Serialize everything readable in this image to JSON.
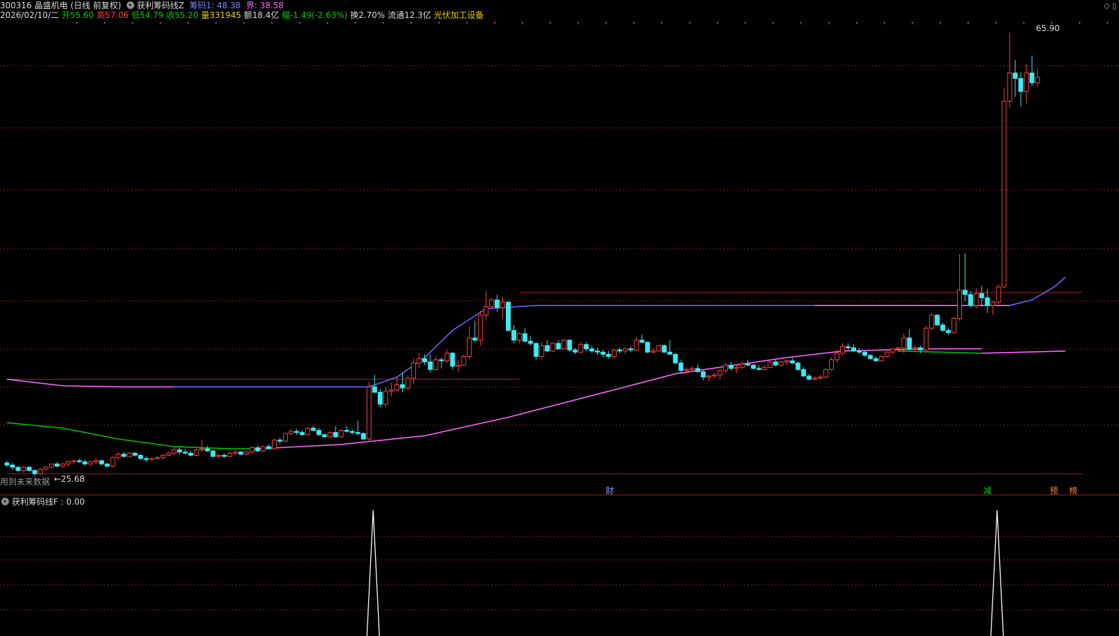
{
  "header": {
    "code": "300316",
    "name": "晶盛机电",
    "mode": "(日线 前复权)",
    "indicator": "获利筹码线Z",
    "chip1_label": "筹码1: 48.38",
    "jie_label": "界: 38.58"
  },
  "quote": {
    "date": "2026/02/10/二",
    "open": "开55.60",
    "high": "高57.06",
    "low": "低54.79",
    "close": "收55.20",
    "volume": "量331945",
    "amount": "额18.4亿",
    "change": "幅-1.49(-2.63%)",
    "turnover": "换2.70%",
    "float": "流通12.3亿",
    "sector": "光伏加工设备"
  },
  "annotations": {
    "future_data": "用到未来数据",
    "low_marker": "←25.68",
    "high_marker": "65.90",
    "event_cai": "财",
    "event_jian": "减",
    "event_yu": "预",
    "event_bang": "榜"
  },
  "sub_panel": {
    "title": "获利筹码线F",
    "value": ": 0.00"
  },
  "colors": {
    "up": "#ff4040",
    "down": "#40e8f0",
    "grid": "#8b1a1a",
    "line_blue": "#6666ff",
    "line_magenta": "#ff66ff",
    "line_green": "#00c000"
  },
  "chart_data": {
    "type": "candlestick",
    "price_range": [
      25.68,
      65.9
    ],
    "candles": [
      [
        26.3,
        26.5,
        25.9,
        26.1
      ],
      [
        26.1,
        26.3,
        25.7,
        25.9
      ],
      [
        25.9,
        26.0,
        25.5,
        25.6
      ],
      [
        25.6,
        26.0,
        25.4,
        25.9
      ],
      [
        25.9,
        26.0,
        25.5,
        25.6
      ],
      [
        25.6,
        25.7,
        25.1,
        25.3
      ],
      [
        25.3,
        25.8,
        25.2,
        25.7
      ],
      [
        25.7,
        26.0,
        25.6,
        25.9
      ],
      [
        25.9,
        26.2,
        25.8,
        26.2
      ],
      [
        26.2,
        26.4,
        25.9,
        26.0
      ],
      [
        26.0,
        26.3,
        25.9,
        26.2
      ],
      [
        26.2,
        26.5,
        26.0,
        26.4
      ],
      [
        26.4,
        26.6,
        26.2,
        26.5
      ],
      [
        26.5,
        26.7,
        26.3,
        26.4
      ],
      [
        26.4,
        26.6,
        26.1,
        26.2
      ],
      [
        26.2,
        26.5,
        26.1,
        26.4
      ],
      [
        26.4,
        26.7,
        26.2,
        26.5
      ],
      [
        26.5,
        26.6,
        26.1,
        26.2
      ],
      [
        26.2,
        26.3,
        25.9,
        26.0
      ],
      [
        26.0,
        26.9,
        25.9,
        26.8
      ],
      [
        26.8,
        27.3,
        26.6,
        27.1
      ],
      [
        27.1,
        27.3,
        26.8,
        26.9
      ],
      [
        26.9,
        27.3,
        26.9,
        27.2
      ],
      [
        27.2,
        27.3,
        26.9,
        27.0
      ],
      [
        27.0,
        27.1,
        26.6,
        26.7
      ],
      [
        26.7,
        26.9,
        26.4,
        26.6
      ],
      [
        26.6,
        26.8,
        26.5,
        26.7
      ],
      [
        26.7,
        26.9,
        26.6,
        26.8
      ],
      [
        26.8,
        27.1,
        26.6,
        27.0
      ],
      [
        27.0,
        27.3,
        26.9,
        27.2
      ],
      [
        27.2,
        27.7,
        27.0,
        27.5
      ],
      [
        27.5,
        27.7,
        27.1,
        27.3
      ],
      [
        27.3,
        27.6,
        27.1,
        27.2
      ],
      [
        27.2,
        27.4,
        26.9,
        27.0
      ],
      [
        27.0,
        27.6,
        26.9,
        27.5
      ],
      [
        27.5,
        28.4,
        27.3,
        27.6
      ],
      [
        27.6,
        27.9,
        27.3,
        27.4
      ],
      [
        27.4,
        27.5,
        26.8,
        26.9
      ],
      [
        26.9,
        27.1,
        26.8,
        27.0
      ],
      [
        27.0,
        27.2,
        26.8,
        26.9
      ],
      [
        26.9,
        27.3,
        26.8,
        27.2
      ],
      [
        27.2,
        27.5,
        27.0,
        27.3
      ],
      [
        27.3,
        27.4,
        27.0,
        27.1
      ],
      [
        27.1,
        27.4,
        27.0,
        27.3
      ],
      [
        27.3,
        27.8,
        27.2,
        27.7
      ],
      [
        27.7,
        27.9,
        27.3,
        27.4
      ],
      [
        27.4,
        27.9,
        27.3,
        27.8
      ],
      [
        27.8,
        28.0,
        27.5,
        27.6
      ],
      [
        27.6,
        28.5,
        27.5,
        28.4
      ],
      [
        28.4,
        28.6,
        28.1,
        28.3
      ],
      [
        28.3,
        29.1,
        28.2,
        29.0
      ],
      [
        29.0,
        29.4,
        28.8,
        29.2
      ],
      [
        29.2,
        29.4,
        28.9,
        29.1
      ],
      [
        29.1,
        29.3,
        28.8,
        28.9
      ],
      [
        28.9,
        29.6,
        28.8,
        29.5
      ],
      [
        29.5,
        29.7,
        29.2,
        29.3
      ],
      [
        29.3,
        29.5,
        28.8,
        28.9
      ],
      [
        28.9,
        29.0,
        28.6,
        28.7
      ],
      [
        28.7,
        29.2,
        28.6,
        29.1
      ],
      [
        29.1,
        29.7,
        28.6,
        28.7
      ],
      [
        28.7,
        29.4,
        28.6,
        29.3
      ],
      [
        29.3,
        29.7,
        29.1,
        29.2
      ],
      [
        29.2,
        29.4,
        28.9,
        29.1
      ],
      [
        29.1,
        30.2,
        28.8,
        29.0
      ],
      [
        29.0,
        29.1,
        28.4,
        28.5
      ],
      [
        28.5,
        33.8,
        28.3,
        33.3
      ],
      [
        33.3,
        34.4,
        32.8,
        32.8
      ],
      [
        32.8,
        33.1,
        31.4,
        31.7
      ],
      [
        31.7,
        33.3,
        31.4,
        32.9
      ],
      [
        32.9,
        33.7,
        32.4,
        33.0
      ],
      [
        33.0,
        34.3,
        32.9,
        33.5
      ],
      [
        33.5,
        34.6,
        32.8,
        33.2
      ],
      [
        33.2,
        34.3,
        33.0,
        34.1
      ],
      [
        34.1,
        35.9,
        33.6,
        35.5
      ],
      [
        35.5,
        36.4,
        35.0,
        35.9
      ],
      [
        35.9,
        36.3,
        35.3,
        35.6
      ],
      [
        35.6,
        36.3,
        34.6,
        34.9
      ],
      [
        34.9,
        36.1,
        34.8,
        35.8
      ],
      [
        35.8,
        36.0,
        35.0,
        35.7
      ],
      [
        35.7,
        36.7,
        35.5,
        36.4
      ],
      [
        36.4,
        36.5,
        34.9,
        35.2
      ],
      [
        35.2,
        35.8,
        34.7,
        35.3
      ],
      [
        35.3,
        36.3,
        35.2,
        36.1
      ],
      [
        36.1,
        38.9,
        35.8,
        37.8
      ],
      [
        37.8,
        39.4,
        37.4,
        37.6
      ],
      [
        37.6,
        40.3,
        37.1,
        39.9
      ],
      [
        39.9,
        42.1,
        39.4,
        40.7
      ],
      [
        40.7,
        41.5,
        40.5,
        41.3
      ],
      [
        41.3,
        41.8,
        40.2,
        40.6
      ],
      [
        40.6,
        41.6,
        39.6,
        41.1
      ],
      [
        41.1,
        41.2,
        38.4,
        38.5
      ],
      [
        38.5,
        39.0,
        37.3,
        37.6
      ],
      [
        37.6,
        38.3,
        37.3,
        38.2
      ],
      [
        38.2,
        38.7,
        37.4,
        37.5
      ],
      [
        37.5,
        38.0,
        37.1,
        37.3
      ],
      [
        37.3,
        37.4,
        35.8,
        36.1
      ],
      [
        36.1,
        37.4,
        35.9,
        37.1
      ],
      [
        37.1,
        37.6,
        36.5,
        36.6
      ],
      [
        36.6,
        37.4,
        36.5,
        37.3
      ],
      [
        37.3,
        37.6,
        36.7,
        36.8
      ],
      [
        36.8,
        37.7,
        36.7,
        37.6
      ],
      [
        37.6,
        37.7,
        36.5,
        36.7
      ],
      [
        36.7,
        36.9,
        36.3,
        36.5
      ],
      [
        36.5,
        37.4,
        36.4,
        37.2
      ],
      [
        37.2,
        37.4,
        36.6,
        36.8
      ],
      [
        36.8,
        37.1,
        36.4,
        36.6
      ],
      [
        36.6,
        36.9,
        36.2,
        36.5
      ],
      [
        36.5,
        36.7,
        36.0,
        36.3
      ],
      [
        36.3,
        36.6,
        35.9,
        36.1
      ],
      [
        36.1,
        36.8,
        35.9,
        36.7
      ],
      [
        36.7,
        36.9,
        36.4,
        36.6
      ],
      [
        36.6,
        36.9,
        36.3,
        36.8
      ],
      [
        36.8,
        37.0,
        36.5,
        36.7
      ],
      [
        36.7,
        37.9,
        36.6,
        37.6
      ],
      [
        37.6,
        38.1,
        37.3,
        37.4
      ],
      [
        37.4,
        37.5,
        36.4,
        36.5
      ],
      [
        36.5,
        36.9,
        36.4,
        36.6
      ],
      [
        36.6,
        37.2,
        36.5,
        37.1
      ],
      [
        37.1,
        37.2,
        36.4,
        36.5
      ],
      [
        36.5,
        37.6,
        36.3,
        36.3
      ],
      [
        36.3,
        36.4,
        35.4,
        35.5
      ],
      [
        35.5,
        35.8,
        34.5,
        34.8
      ],
      [
        34.8,
        35.1,
        34.5,
        34.9
      ],
      [
        34.9,
        35.2,
        34.7,
        35.0
      ],
      [
        35.0,
        35.4,
        34.6,
        34.7
      ],
      [
        34.7,
        34.8,
        33.9,
        34.2
      ],
      [
        34.2,
        34.4,
        33.8,
        34.3
      ],
      [
        34.3,
        34.6,
        34.1,
        34.4
      ],
      [
        34.4,
        35.0,
        34.0,
        34.8
      ],
      [
        34.8,
        35.5,
        34.6,
        35.3
      ],
      [
        35.3,
        35.6,
        34.8,
        35.0
      ],
      [
        35.0,
        35.3,
        34.6,
        35.1
      ],
      [
        35.1,
        35.6,
        34.9,
        35.4
      ],
      [
        35.4,
        35.8,
        35.2,
        35.3
      ],
      [
        35.3,
        35.4,
        34.9,
        35.0
      ],
      [
        35.0,
        35.3,
        34.8,
        34.9
      ],
      [
        34.9,
        35.3,
        34.8,
        35.1
      ],
      [
        35.1,
        35.7,
        35.0,
        35.6
      ],
      [
        35.6,
        35.9,
        35.2,
        35.3
      ],
      [
        35.3,
        35.7,
        35.2,
        35.6
      ],
      [
        35.6,
        35.8,
        35.3,
        35.7
      ],
      [
        35.7,
        36.0,
        35.4,
        35.5
      ],
      [
        35.5,
        35.6,
        34.8,
        34.9
      ],
      [
        34.9,
        35.1,
        34.2,
        34.3
      ],
      [
        34.3,
        34.5,
        33.9,
        34.0
      ],
      [
        34.0,
        34.3,
        33.9,
        34.1
      ],
      [
        34.1,
        34.4,
        34.0,
        34.2
      ],
      [
        34.2,
        35.0,
        34.1,
        34.9
      ],
      [
        34.9,
        36.0,
        34.8,
        35.8
      ],
      [
        35.8,
        36.7,
        35.5,
        36.4
      ],
      [
        36.4,
        37.3,
        36.2,
        37.0
      ],
      [
        37.0,
        37.3,
        36.7,
        36.9
      ],
      [
        36.9,
        37.2,
        36.5,
        36.6
      ],
      [
        36.6,
        36.9,
        36.3,
        36.5
      ],
      [
        36.5,
        36.6,
        36.1,
        36.2
      ],
      [
        36.2,
        36.3,
        35.8,
        35.9
      ],
      [
        35.9,
        36.1,
        35.6,
        35.7
      ],
      [
        35.7,
        36.2,
        35.6,
        36.1
      ],
      [
        36.1,
        36.6,
        36.0,
        36.5
      ],
      [
        36.5,
        36.9,
        36.3,
        36.8
      ],
      [
        36.8,
        37.0,
        36.5,
        36.9
      ],
      [
        36.9,
        38.2,
        36.4,
        37.8
      ],
      [
        37.8,
        38.6,
        36.6,
        36.8
      ],
      [
        36.8,
        37.2,
        36.5,
        36.9
      ],
      [
        36.9,
        37.1,
        36.4,
        36.7
      ],
      [
        36.7,
        38.9,
        36.6,
        38.7
      ],
      [
        38.7,
        40.1,
        38.5,
        39.9
      ],
      [
        39.9,
        40.0,
        38.9,
        39.0
      ],
      [
        39.0,
        39.2,
        38.4,
        38.5
      ],
      [
        38.5,
        38.7,
        38.1,
        38.3
      ],
      [
        38.3,
        39.7,
        38.2,
        39.6
      ],
      [
        39.6,
        45.5,
        39.4,
        42.2
      ],
      [
        42.2,
        45.6,
        41.2,
        41.8
      ],
      [
        41.8,
        42.1,
        40.6,
        40.8
      ],
      [
        40.8,
        42.4,
        40.5,
        41.9
      ],
      [
        41.9,
        42.6,
        40.7,
        41.5
      ],
      [
        41.5,
        42.3,
        40.1,
        40.8
      ],
      [
        40.8,
        41.2,
        39.9,
        41.1
      ],
      [
        41.1,
        42.7,
        40.9,
        42.5
      ],
      [
        42.5,
        60.8,
        42.4,
        59.6
      ],
      [
        59.6,
        65.9,
        59.0,
        62.2
      ],
      [
        62.2,
        63.4,
        60.0,
        61.7
      ],
      [
        61.7,
        62.3,
        59.1,
        60.5
      ],
      [
        60.5,
        63.0,
        59.4,
        62.2
      ],
      [
        62.2,
        63.8,
        61.0,
        61.3
      ],
      [
        61.3,
        62.7,
        61.0,
        61.8
      ]
    ],
    "curves": [
      {
        "name": "",
        "color": "#ff66ff",
        "points": [
          [
            0,
            34
          ],
          [
            10,
            33.4
          ],
          [
            20,
            33.3
          ],
          [
            30,
            33.3
          ]
        ]
      },
      {
        "name": "",
        "color": "#6666ff",
        "points": [
          [
            30,
            33.3
          ],
          [
            65,
            33.3
          ],
          [
            70,
            34.2
          ],
          [
            75,
            36
          ],
          [
            80,
            38.5
          ],
          [
            86,
            40.5
          ],
          [
            95,
            40.8
          ],
          [
            145,
            40.8
          ]
        ]
      },
      {
        "name": "",
        "color": "#ff66ff",
        "points": [
          [
            145,
            40.8
          ],
          [
            180,
            40.8
          ]
        ]
      },
      {
        "name": "",
        "color": "#6666ff",
        "points": [
          [
            180,
            40.8
          ],
          [
            184,
            41.3
          ],
          [
            188,
            42.5
          ],
          [
            190,
            43.4
          ]
        ]
      },
      {
        "name": "",
        "color": "#00c000",
        "points": [
          [
            0,
            30.0
          ],
          [
            10,
            29.5
          ],
          [
            20,
            28.5
          ],
          [
            30,
            27.8
          ],
          [
            40,
            27.6
          ],
          [
            45,
            27.6
          ]
        ]
      },
      {
        "name": "",
        "color": "#ff66ff",
        "points": [
          [
            45,
            27.6
          ],
          [
            60,
            28.0
          ],
          [
            75,
            28.8
          ],
          [
            90,
            30.5
          ],
          [
            105,
            32.5
          ],
          [
            120,
            34.5
          ],
          [
            140,
            36.0
          ],
          [
            150,
            36.6
          ],
          [
            165,
            36.8
          ],
          [
            175,
            36.8
          ]
        ]
      },
      {
        "name": "",
        "color": "#00c000",
        "points": [
          [
            160,
            36.6
          ],
          [
            175,
            36.4
          ]
        ]
      },
      {
        "name": "",
        "color": "#ff66ff",
        "points": [
          [
            175,
            36.4
          ],
          [
            190,
            36.6
          ]
        ]
      }
    ],
    "h_lines": [
      {
        "price": 34.0,
        "from": 0,
        "to": 92
      },
      {
        "price": 42.0,
        "from": 92,
        "to": 193
      },
      {
        "price": 25.3,
        "from": 0,
        "to": 193
      }
    ],
    "sub_spikes": [
      65,
      177
    ]
  }
}
